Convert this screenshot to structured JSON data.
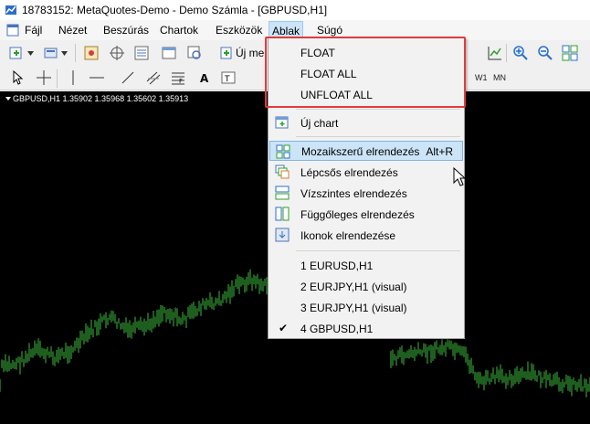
{
  "window": {
    "title": "18783152: MetaQuotes-Demo - Demo Számla - [GBPUSD,H1]"
  },
  "menubar": {
    "items": [
      "Fájl",
      "Nézet",
      "Beszúrás",
      "Chartok",
      "Eszközök",
      "Ablak",
      "Súgó"
    ],
    "active": "Ablak"
  },
  "toolbar": {
    "new_order_label": "Új me",
    "timeframes": [
      "W1",
      "MN"
    ]
  },
  "chart": {
    "symbol": "GBPUSD,H1",
    "ohlc": [
      "1.35902",
      "1.35968",
      "1.35602",
      "1.35913"
    ],
    "header": "GBPUSD,H1  1.35902 1.35968 1.35602 1.35913",
    "line_color": "#3dbb3d",
    "background": "#000000"
  },
  "dropdown": {
    "float_items": [
      "FLOAT",
      "FLOAT ALL",
      "UNFLOAT ALL"
    ],
    "new_chart": "Új chart",
    "layouts": [
      {
        "label": "Mozaikszerű elrendezés",
        "shortcut": "Alt+R",
        "icon": "tile-windows-icon",
        "highlighted": true
      },
      {
        "label": "Lépcsős elrendezés",
        "shortcut": "",
        "icon": "cascade-windows-icon",
        "highlighted": false
      },
      {
        "label": "Vízszintes elrendezés",
        "shortcut": "",
        "icon": "tile-horizontal-icon",
        "highlighted": false
      },
      {
        "label": "Függőleges elrendezés",
        "shortcut": "",
        "icon": "tile-vertical-icon",
        "highlighted": false
      },
      {
        "label": "Ikonok elrendezése",
        "shortcut": "",
        "icon": "arrange-icons-icon",
        "highlighted": false
      }
    ],
    "windows": [
      {
        "label": "1 EURUSD,H1",
        "checked": false
      },
      {
        "label": "2 EURJPY,H1 (visual)",
        "checked": false
      },
      {
        "label": "3 EURJPY,H1 (visual)",
        "checked": false
      },
      {
        "label": "4 GBPUSD,H1",
        "checked": true
      }
    ],
    "highlight_color": "#cce4f7",
    "annotation_color": "#e03c3c"
  }
}
